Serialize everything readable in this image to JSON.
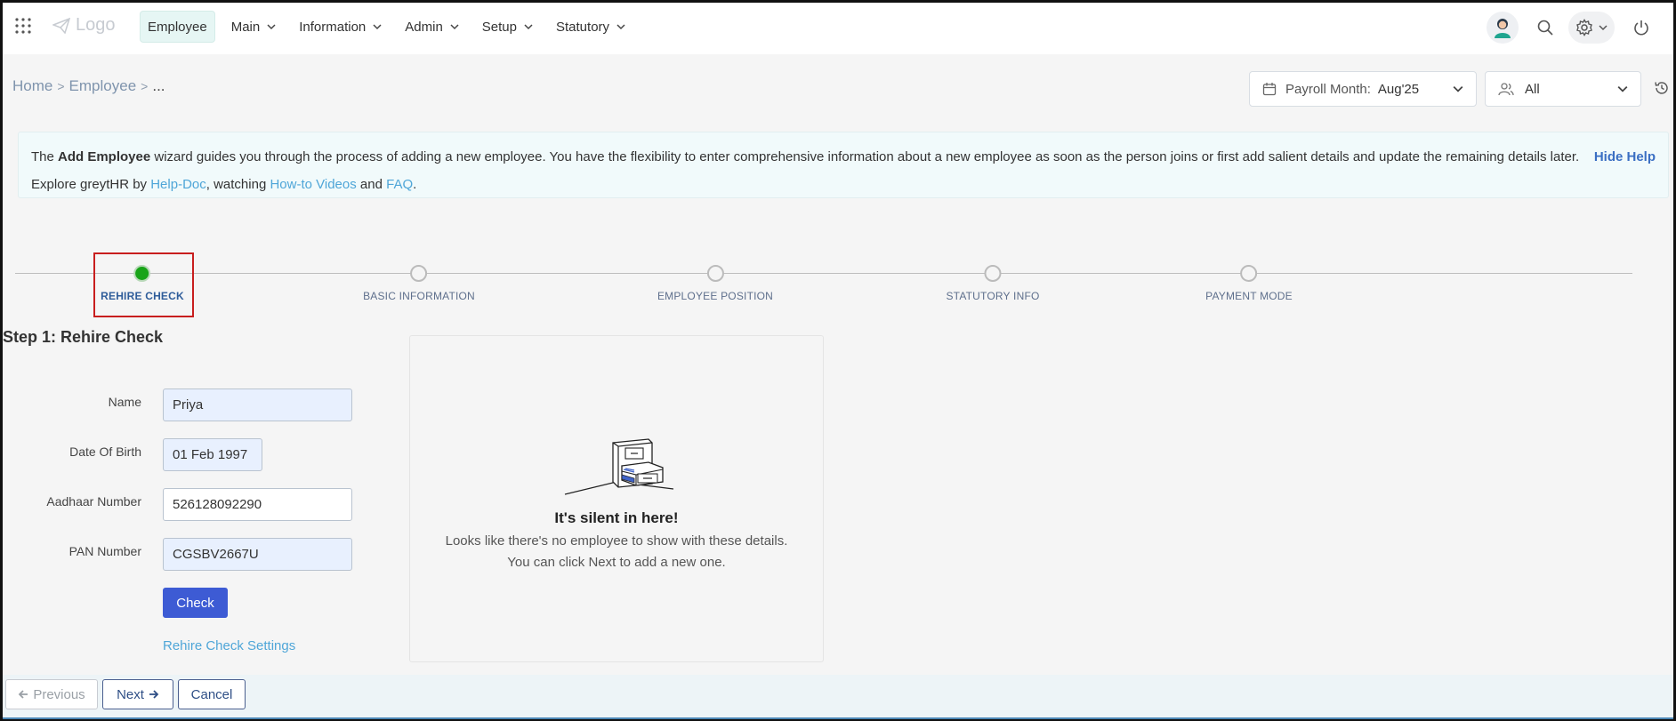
{
  "nav": {
    "logo": "Logo",
    "items": [
      {
        "label": "Employee",
        "active": true
      },
      {
        "label": "Main",
        "active": false
      },
      {
        "label": "Information",
        "active": false
      },
      {
        "label": "Admin",
        "active": false
      },
      {
        "label": "Setup",
        "active": false
      },
      {
        "label": "Statutory",
        "active": false
      }
    ]
  },
  "breadcrumb": {
    "home": "Home",
    "employee": "Employee",
    "current": "..."
  },
  "payroll": {
    "label": "Payroll Month:",
    "value": "Aug'25"
  },
  "filter": {
    "value": "All"
  },
  "help": {
    "line1_pre": "The ",
    "line1_bold": "Add Employee",
    "line1_post": " wizard guides you through the process of adding a new employee. You have the flexibility to enter comprehensive information about a new employee as soon as the person joins or first add salient details and update the remaining details later.",
    "line2_pre": "Explore greytHR by ",
    "link_helpdoc": "Help-Doc",
    "line2_mid1": ", watching ",
    "link_videos": "How-to Videos",
    "line2_mid2": " and ",
    "link_faq": "FAQ",
    "line2_end": ".",
    "hide": "Hide Help"
  },
  "steps": [
    {
      "label": "REHIRE CHECK",
      "state": "done"
    },
    {
      "label": "BASIC INFORMATION",
      "state": "pending"
    },
    {
      "label": "EMPLOYEE POSITION",
      "state": "pending"
    },
    {
      "label": "STATUTORY INFO",
      "state": "pending"
    },
    {
      "label": "PAYMENT MODE",
      "state": "pending"
    }
  ],
  "form": {
    "title": "Step 1: Rehire Check",
    "name_label": "Name",
    "name_value": "Priya",
    "dob_label": "Date Of Birth",
    "dob_value": "01 Feb 1997",
    "aadhaar_label": "Aadhaar Number",
    "aadhaar_value": "526128092290",
    "pan_label": "PAN Number",
    "pan_value": "CGSBV2667U",
    "check_label": "Check",
    "settings_link": "Rehire Check Settings"
  },
  "empty": {
    "title": "It's silent in here!",
    "line1": "Looks like there's no employee to show with these details.",
    "line2": "You can click Next to add a new one."
  },
  "footer": {
    "previous": "Previous",
    "next": "Next",
    "cancel": "Cancel"
  },
  "colors": {
    "primary": "#3d5bd4",
    "link": "#4fa6d8",
    "success": "#18a418",
    "highlight": "#c81e1e"
  }
}
